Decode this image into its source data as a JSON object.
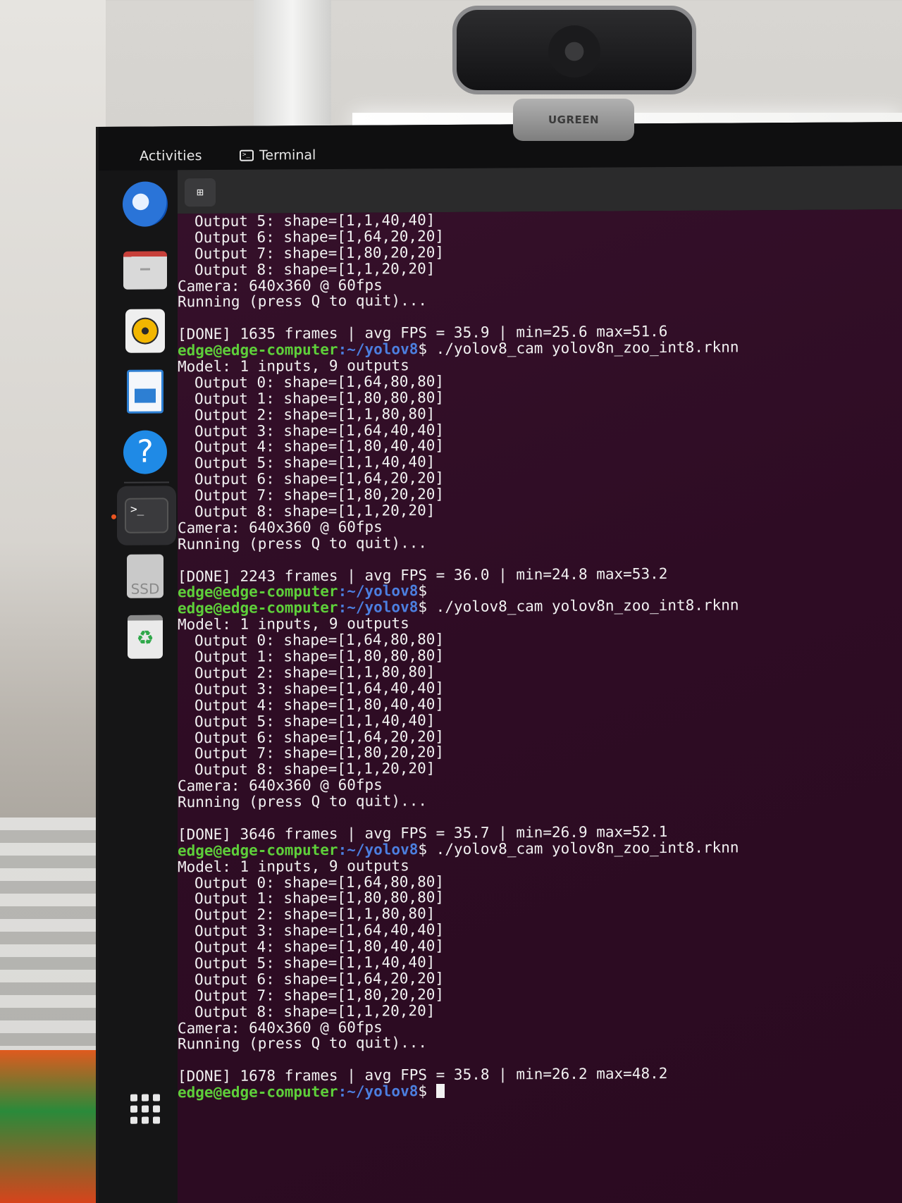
{
  "topbar": {
    "activities": "Activities",
    "app_name": "Terminal"
  },
  "webcam": {
    "brand": "UGREEN"
  },
  "dock": {
    "items": [
      {
        "icon": "thunderbird-icon"
      },
      {
        "icon": "files-icon"
      },
      {
        "icon": "rhythmbox-icon"
      },
      {
        "icon": "writer-icon"
      },
      {
        "icon": "help-icon"
      },
      {
        "icon": "terminal-icon",
        "active": true
      },
      {
        "icon": "ssd-drive-icon",
        "label": "SSD"
      },
      {
        "icon": "trash-icon"
      },
      {
        "icon": "show-apps-icon"
      }
    ]
  },
  "terminal": {
    "newtab_icon": "new-tab-icon",
    "prompt_user": "edge@edge-computer",
    "prompt_path": ":~/yolov8",
    "prompt_symbol": "$",
    "lines": [
      {
        "type": "out",
        "indent": true,
        "text": "Output 5: shape=[1,1,40,40]"
      },
      {
        "type": "out",
        "indent": true,
        "text": "Output 6: shape=[1,64,20,20]"
      },
      {
        "type": "out",
        "indent": true,
        "text": "Output 7: shape=[1,80,20,20]"
      },
      {
        "type": "out",
        "indent": true,
        "text": "Output 8: shape=[1,1,20,20]"
      },
      {
        "type": "out",
        "text": "Camera: 640x360 @ 60fps"
      },
      {
        "type": "out",
        "text": "Running (press Q to quit)..."
      },
      {
        "type": "blank"
      },
      {
        "type": "out",
        "text": "[DONE] 1635 frames | avg FPS = 35.9 | min=25.6 max=51.6"
      },
      {
        "type": "prompt",
        "cmd": " ./yolov8_cam yolov8n_zoo_int8.rknn"
      },
      {
        "type": "out",
        "text": "Model: 1 inputs, 9 outputs"
      },
      {
        "type": "out",
        "indent": true,
        "text": "Output 0: shape=[1,64,80,80]"
      },
      {
        "type": "out",
        "indent": true,
        "text": "Output 1: shape=[1,80,80,80]"
      },
      {
        "type": "out",
        "indent": true,
        "text": "Output 2: shape=[1,1,80,80]"
      },
      {
        "type": "out",
        "indent": true,
        "text": "Output 3: shape=[1,64,40,40]"
      },
      {
        "type": "out",
        "indent": true,
        "text": "Output 4: shape=[1,80,40,40]"
      },
      {
        "type": "out",
        "indent": true,
        "text": "Output 5: shape=[1,1,40,40]"
      },
      {
        "type": "out",
        "indent": true,
        "text": "Output 6: shape=[1,64,20,20]"
      },
      {
        "type": "out",
        "indent": true,
        "text": "Output 7: shape=[1,80,20,20]"
      },
      {
        "type": "out",
        "indent": true,
        "text": "Output 8: shape=[1,1,20,20]"
      },
      {
        "type": "out",
        "text": "Camera: 640x360 @ 60fps"
      },
      {
        "type": "out",
        "text": "Running (press Q to quit)..."
      },
      {
        "type": "blank"
      },
      {
        "type": "out",
        "text": "[DONE] 2243 frames | avg FPS = 36.0 | min=24.8 max=53.2"
      },
      {
        "type": "prompt",
        "cmd": ""
      },
      {
        "type": "prompt",
        "cmd": " ./yolov8_cam yolov8n_zoo_int8.rknn"
      },
      {
        "type": "out",
        "text": "Model: 1 inputs, 9 outputs"
      },
      {
        "type": "out",
        "indent": true,
        "text": "Output 0: shape=[1,64,80,80]"
      },
      {
        "type": "out",
        "indent": true,
        "text": "Output 1: shape=[1,80,80,80]"
      },
      {
        "type": "out",
        "indent": true,
        "text": "Output 2: shape=[1,1,80,80]"
      },
      {
        "type": "out",
        "indent": true,
        "text": "Output 3: shape=[1,64,40,40]"
      },
      {
        "type": "out",
        "indent": true,
        "text": "Output 4: shape=[1,80,40,40]"
      },
      {
        "type": "out",
        "indent": true,
        "text": "Output 5: shape=[1,1,40,40]"
      },
      {
        "type": "out",
        "indent": true,
        "text": "Output 6: shape=[1,64,20,20]"
      },
      {
        "type": "out",
        "indent": true,
        "text": "Output 7: shape=[1,80,20,20]"
      },
      {
        "type": "out",
        "indent": true,
        "text": "Output 8: shape=[1,1,20,20]"
      },
      {
        "type": "out",
        "text": "Camera: 640x360 @ 60fps"
      },
      {
        "type": "out",
        "text": "Running (press Q to quit)..."
      },
      {
        "type": "blank"
      },
      {
        "type": "out",
        "text": "[DONE] 3646 frames | avg FPS = 35.7 | min=26.9 max=52.1"
      },
      {
        "type": "prompt",
        "cmd": " ./yolov8_cam yolov8n_zoo_int8.rknn"
      },
      {
        "type": "out",
        "text": "Model: 1 inputs, 9 outputs"
      },
      {
        "type": "out",
        "indent": true,
        "text": "Output 0: shape=[1,64,80,80]"
      },
      {
        "type": "out",
        "indent": true,
        "text": "Output 1: shape=[1,80,80,80]"
      },
      {
        "type": "out",
        "indent": true,
        "text": "Output 2: shape=[1,1,80,80]"
      },
      {
        "type": "out",
        "indent": true,
        "text": "Output 3: shape=[1,64,40,40]"
      },
      {
        "type": "out",
        "indent": true,
        "text": "Output 4: shape=[1,80,40,40]"
      },
      {
        "type": "out",
        "indent": true,
        "text": "Output 5: shape=[1,1,40,40]"
      },
      {
        "type": "out",
        "indent": true,
        "text": "Output 6: shape=[1,64,20,20]"
      },
      {
        "type": "out",
        "indent": true,
        "text": "Output 7: shape=[1,80,20,20]"
      },
      {
        "type": "out",
        "indent": true,
        "text": "Output 8: shape=[1,1,20,20]"
      },
      {
        "type": "out",
        "text": "Camera: 640x360 @ 60fps"
      },
      {
        "type": "out",
        "text": "Running (press Q to quit)..."
      },
      {
        "type": "blank"
      },
      {
        "type": "out",
        "text": "[DONE] 1678 frames | avg FPS = 35.8 | min=26.2 max=48.2"
      },
      {
        "type": "prompt",
        "cmd": " ",
        "cursor": true
      }
    ]
  }
}
